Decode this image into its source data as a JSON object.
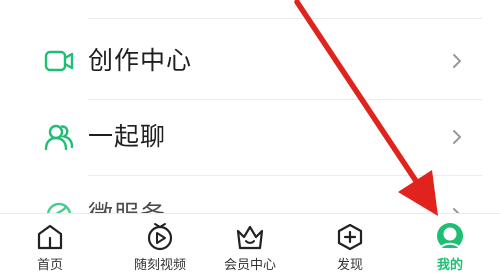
{
  "menu": {
    "items": [
      {
        "label": "创作中心",
        "icon": "video-camera-icon"
      },
      {
        "label": "一起聊",
        "icon": "chat-people-icon"
      },
      {
        "label": "微服务",
        "icon": "service-icon"
      }
    ]
  },
  "tabbar": {
    "tabs": [
      {
        "label": "首页",
        "icon": "home-icon",
        "active": false
      },
      {
        "label": "随刻视频",
        "icon": "video-play-icon",
        "active": false
      },
      {
        "label": "会员中心",
        "icon": "vip-crown-icon",
        "active": false
      },
      {
        "label": "发现",
        "icon": "discover-plus-icon",
        "active": false
      },
      {
        "label": "我的",
        "icon": "profile-avatar-icon",
        "active": true
      }
    ]
  },
  "colors": {
    "accent": "#1dbf73",
    "arrow": "#e0231c"
  }
}
